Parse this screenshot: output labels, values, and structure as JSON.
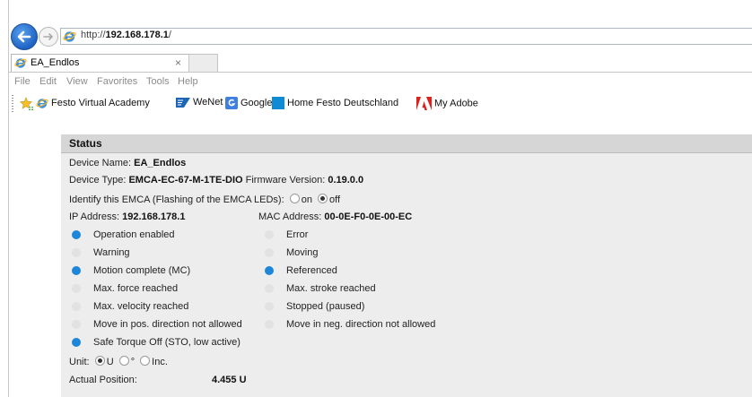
{
  "browser": {
    "url_prefix": "http://",
    "url_host": "192.168.178.1",
    "url_suffix": "/",
    "tab_title": "EA_Endlos",
    "tab_close": "×",
    "menu": [
      "File",
      "Edit",
      "View",
      "Favorites",
      "Tools",
      "Help"
    ],
    "favorites": [
      {
        "label": "Festo Virtual Academy",
        "icon": "ie-icon"
      },
      {
        "label": "WeNet",
        "icon": "sap-icon"
      },
      {
        "label": "Google",
        "icon": "google-icon"
      },
      {
        "label": "Home Festo Deutschland",
        "icon": "festo-icon"
      },
      {
        "label": "My Adobe",
        "icon": "adobe-icon"
      }
    ]
  },
  "status": {
    "title": "Status",
    "device_name_label": "Device Name:",
    "device_name": "EA_Endlos",
    "device_type_label": "Device Type:",
    "device_type": "EMCA-EC-67-M-1TE-DIO",
    "firmware_label": "Firmware Version:",
    "firmware": "0.19.0.0",
    "identify_label": "Identify this EMCA (Flashing of the EMCA LEDs):",
    "identify_on": "on",
    "identify_off": "off",
    "identify_selected": "off",
    "ip_label": "IP Address:",
    "ip": "192.168.178.1",
    "mac_label": "MAC Address:",
    "mac": "00-0E-F0-0E-00-EC",
    "indicators_left": [
      {
        "label": "Operation enabled",
        "active": true
      },
      {
        "label": "Warning",
        "active": false
      },
      {
        "label": "Motion complete (MC)",
        "active": true
      },
      {
        "label": "Max. force reached",
        "active": false
      },
      {
        "label": "Max. velocity reached",
        "active": false
      },
      {
        "label": "Move in pos. direction not allowed",
        "active": false
      },
      {
        "label": "Safe Torque Off (STO, low active)",
        "active": true
      }
    ],
    "indicators_right": [
      {
        "label": "Error",
        "active": false
      },
      {
        "label": "Moving",
        "active": false
      },
      {
        "label": "Referenced",
        "active": true
      },
      {
        "label": "Max. stroke reached",
        "active": false
      },
      {
        "label": "Stopped (paused)",
        "active": false
      },
      {
        "label": "Move in neg. direction not allowed",
        "active": false
      }
    ],
    "unit_label": "Unit:",
    "unit_options": [
      "U",
      "°",
      "Inc."
    ],
    "unit_selected": "U",
    "actual_position_label": "Actual Position:",
    "actual_position": "4.455 U",
    "active_color": "#1e86d8",
    "inactive_color": "#e2e2e2"
  }
}
